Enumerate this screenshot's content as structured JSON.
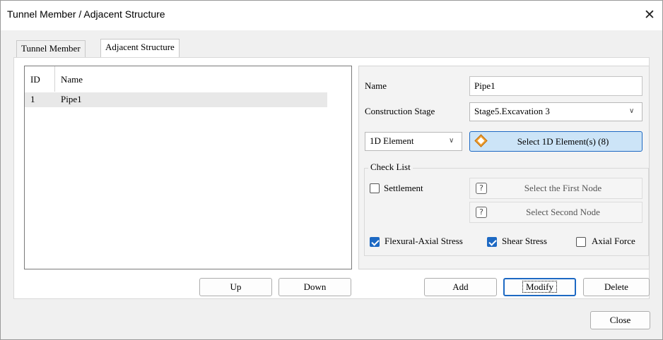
{
  "window": {
    "title": "Tunnel Member / Adjacent Structure"
  },
  "tabs": [
    {
      "label": "Tunnel Member"
    },
    {
      "label": "Adjacent Structure"
    }
  ],
  "list": {
    "columns": [
      "ID",
      "Name"
    ],
    "rows": [
      {
        "id": "1",
        "name": "Pipe1"
      }
    ]
  },
  "list_buttons": {
    "up": "Up",
    "down": "Down"
  },
  "form": {
    "name_label": "Name",
    "name_value": "Pipe1",
    "stage_label": "Construction Stage",
    "stage_value": "Stage5.Excavation 3",
    "element_type": "1D Element",
    "select_button": "Select 1D Element(s) (8)"
  },
  "check_list": {
    "legend": "Check List",
    "settlement": {
      "label": "Settlement",
      "checked": false
    },
    "first_node_button": "Select the First Node",
    "second_node_button": "Select Second Node",
    "flexural": {
      "label": "Flexural-Axial Stress",
      "checked": true
    },
    "shear": {
      "label": "Shear Stress",
      "checked": true
    },
    "axial": {
      "label": "Axial Force",
      "checked": false
    }
  },
  "actions": {
    "add": "Add",
    "modify": "Modify",
    "delete": "Delete",
    "close": "Close"
  },
  "colors": {
    "accent": "#1d69c3",
    "select_button_bg": "#cce4f7",
    "select_button_border": "#1d69c3",
    "icon_orange": "#f0a030"
  }
}
